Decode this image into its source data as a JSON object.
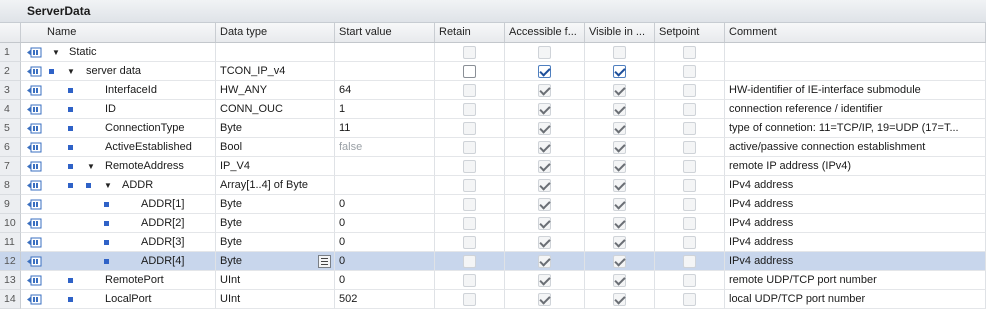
{
  "title": "ServerData",
  "columns": {
    "name": "Name",
    "datatype": "Data type",
    "start": "Start value",
    "retain": "Retain",
    "accessible": "Accessible f...",
    "visible": "Visible in ...",
    "setpoint": "Setpoint",
    "comment": "Comment"
  },
  "rows": [
    {
      "num": "1",
      "name": "Static",
      "type": "",
      "start": "",
      "comment": ""
    },
    {
      "num": "2",
      "name": "server data",
      "type": "TCON_IP_v4",
      "start": "",
      "comment": ""
    },
    {
      "num": "3",
      "name": "InterfaceId",
      "type": "HW_ANY",
      "start": "64",
      "comment": "HW-identifier of IE-interface submodule"
    },
    {
      "num": "4",
      "name": "ID",
      "type": "CONN_OUC",
      "start": "1",
      "comment": "connection reference / identifier"
    },
    {
      "num": "5",
      "name": "ConnectionType",
      "type": "Byte",
      "start": "11",
      "comment": "type of connetion: 11=TCP/IP, 19=UDP (17=T..."
    },
    {
      "num": "6",
      "name": "ActiveEstablished",
      "type": "Bool",
      "start": "false",
      "comment": "active/passive connection establishment"
    },
    {
      "num": "7",
      "name": "RemoteAddress",
      "type": "IP_V4",
      "start": "",
      "comment": "remote IP address (IPv4)"
    },
    {
      "num": "8",
      "name": "ADDR",
      "type": "Array[1..4] of Byte",
      "start": "",
      "comment": "IPv4 address"
    },
    {
      "num": "9",
      "name": "ADDR[1]",
      "type": "Byte",
      "start": "0",
      "comment": "IPv4 address"
    },
    {
      "num": "10",
      "name": "ADDR[2]",
      "type": "Byte",
      "start": "0",
      "comment": "IPv4 address"
    },
    {
      "num": "11",
      "name": "ADDR[3]",
      "type": "Byte",
      "start": "0",
      "comment": "IPv4 address"
    },
    {
      "num": "12",
      "name": "ADDR[4]",
      "type": "Byte",
      "start": "0",
      "comment": "IPv4 address"
    },
    {
      "num": "13",
      "name": "RemotePort",
      "type": "UInt",
      "start": "0",
      "comment": "remote UDP/TCP port number"
    },
    {
      "num": "14",
      "name": "LocalPort",
      "type": "UInt",
      "start": "502",
      "comment": "local UDP/TCP port number"
    }
  ]
}
